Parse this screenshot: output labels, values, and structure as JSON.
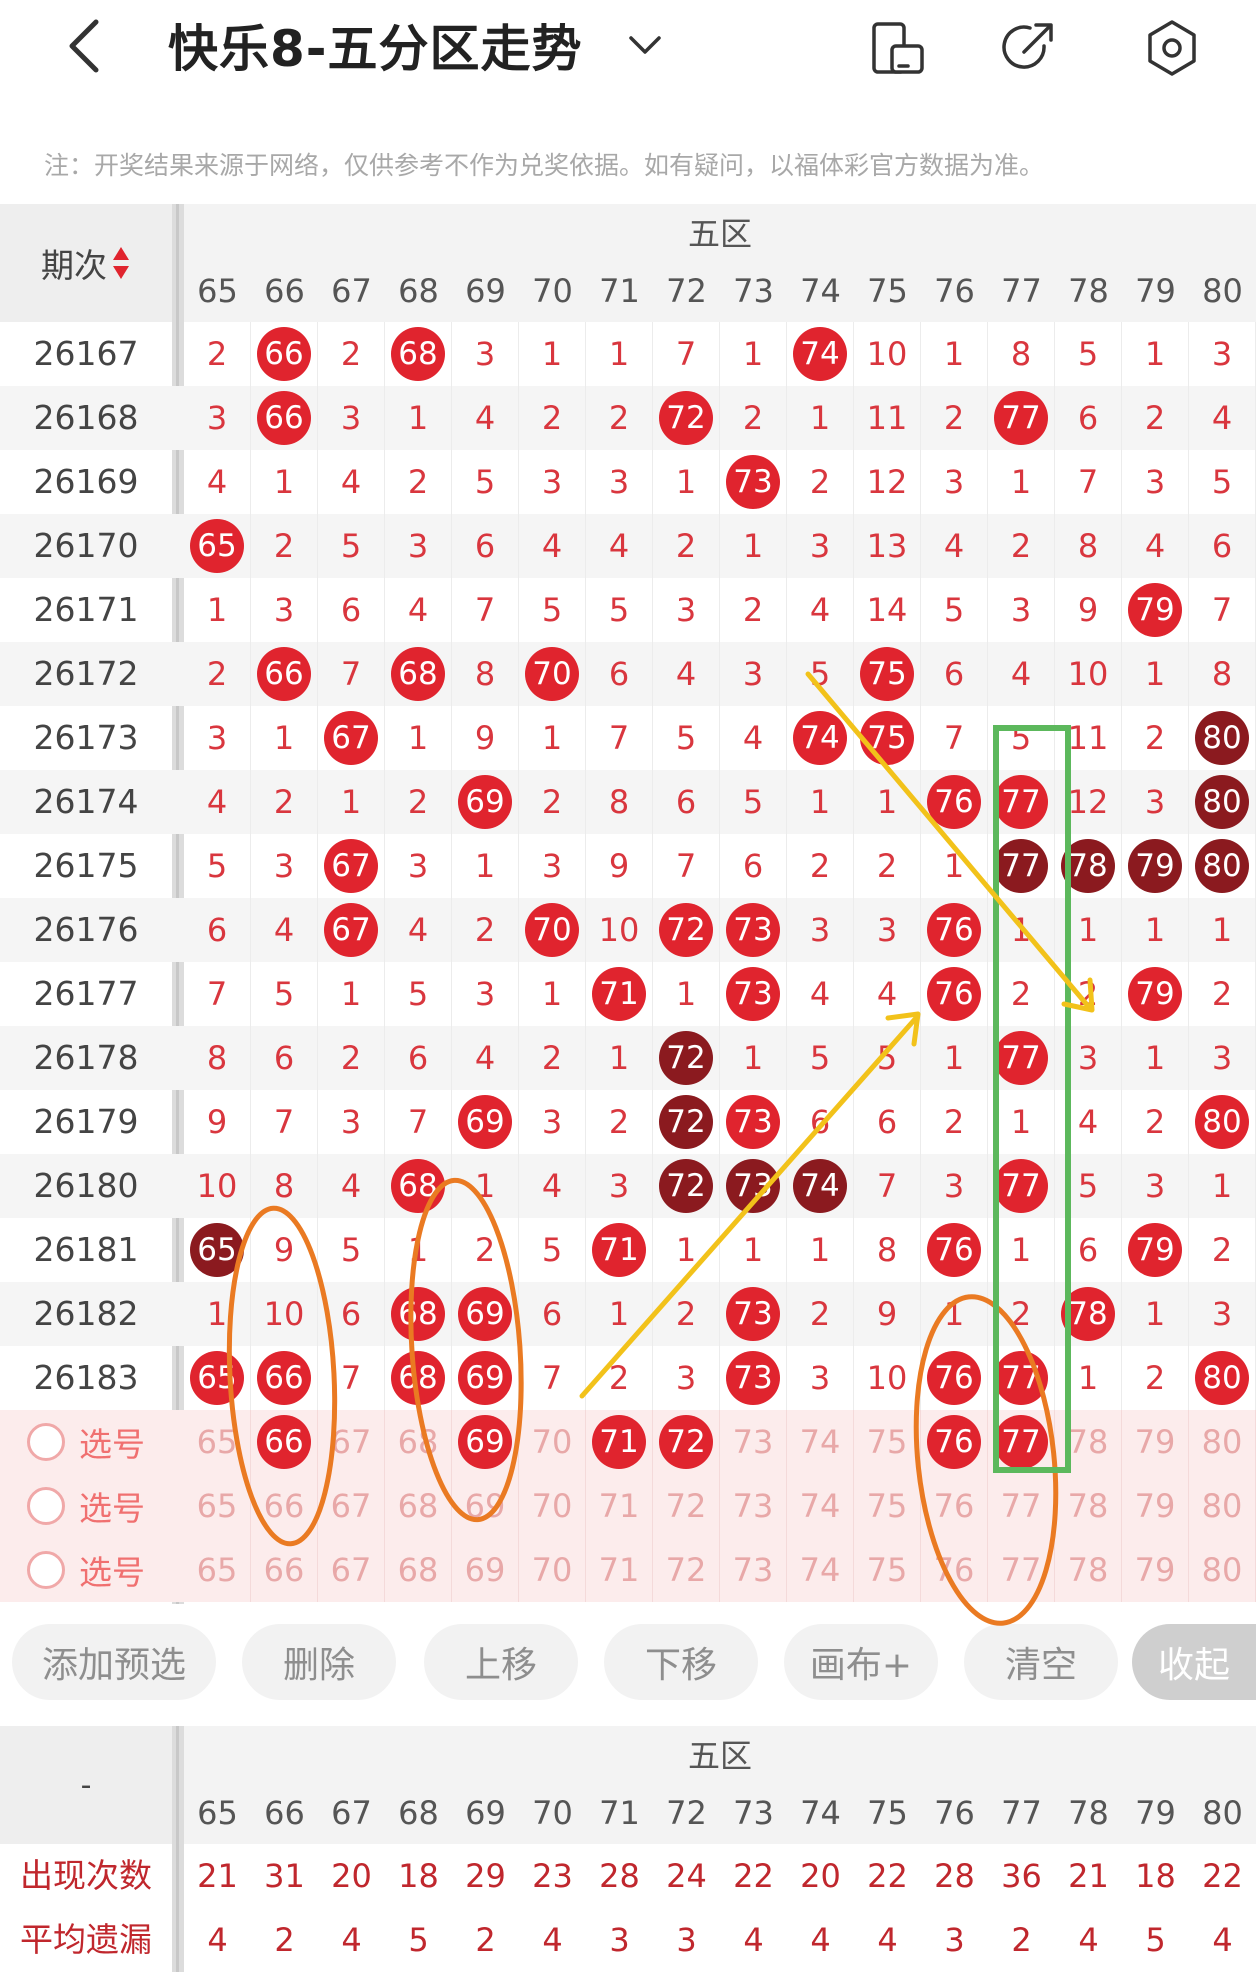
{
  "header": {
    "title": "快乐8-五分区走势",
    "icons": [
      "back-arrow-icon",
      "chevron-down-icon",
      "phone-rotate-icon",
      "share-icon",
      "settings-hex-icon"
    ]
  },
  "notice": "注：开奖结果来源于网络，仅供参考不作为兑奖依据。如有疑问，以福体彩官方数据为准。",
  "table": {
    "issue_header": "期次",
    "zone_label": "五区",
    "columns": [
      "65",
      "66",
      "67",
      "68",
      "69",
      "70",
      "71",
      "72",
      "73",
      "74",
      "75",
      "76",
      "77",
      "78",
      "79",
      "80"
    ],
    "rows": [
      {
        "issue": "26167",
        "cells": [
          "2",
          "66",
          "2",
          "68",
          "3",
          "1",
          "1",
          "7",
          "1",
          "74",
          "10",
          "1",
          "8",
          "5",
          "1",
          "3"
        ],
        "hits": [
          1,
          3,
          9
        ],
        "dark": []
      },
      {
        "issue": "26168",
        "cells": [
          "3",
          "66",
          "3",
          "1",
          "4",
          "2",
          "2",
          "72",
          "2",
          "1",
          "11",
          "2",
          "77",
          "6",
          "2",
          "4"
        ],
        "hits": [
          1,
          7,
          12
        ],
        "dark": []
      },
      {
        "issue": "26169",
        "cells": [
          "4",
          "1",
          "4",
          "2",
          "5",
          "3",
          "3",
          "1",
          "73",
          "2",
          "12",
          "3",
          "1",
          "7",
          "3",
          "5"
        ],
        "hits": [
          8
        ],
        "dark": []
      },
      {
        "issue": "26170",
        "cells": [
          "65",
          "2",
          "5",
          "3",
          "6",
          "4",
          "4",
          "2",
          "1",
          "3",
          "13",
          "4",
          "2",
          "8",
          "4",
          "6"
        ],
        "hits": [
          0
        ],
        "dark": []
      },
      {
        "issue": "26171",
        "cells": [
          "1",
          "3",
          "6",
          "4",
          "7",
          "5",
          "5",
          "3",
          "2",
          "4",
          "14",
          "5",
          "3",
          "9",
          "79",
          "7"
        ],
        "hits": [
          14
        ],
        "dark": []
      },
      {
        "issue": "26172",
        "cells": [
          "2",
          "66",
          "7",
          "68",
          "8",
          "70",
          "6",
          "4",
          "3",
          "5",
          "75",
          "6",
          "4",
          "10",
          "1",
          "8"
        ],
        "hits": [
          1,
          3,
          5,
          10
        ],
        "dark": []
      },
      {
        "issue": "26173",
        "cells": [
          "3",
          "1",
          "67",
          "1",
          "9",
          "1",
          "7",
          "5",
          "4",
          "74",
          "75",
          "7",
          "5",
          "11",
          "2",
          "80"
        ],
        "hits": [
          2,
          9,
          10
        ],
        "dark": [
          15
        ]
      },
      {
        "issue": "26174",
        "cells": [
          "4",
          "2",
          "1",
          "2",
          "69",
          "2",
          "8",
          "6",
          "5",
          "1",
          "1",
          "76",
          "77",
          "12",
          "3",
          "80"
        ],
        "hits": [
          4,
          11,
          12
        ],
        "dark": [
          15
        ]
      },
      {
        "issue": "26175",
        "cells": [
          "5",
          "3",
          "67",
          "3",
          "1",
          "3",
          "9",
          "7",
          "6",
          "2",
          "2",
          "1",
          "77",
          "78",
          "79",
          "80"
        ],
        "hits": [
          2
        ],
        "dark": [
          12,
          13,
          14,
          15
        ]
      },
      {
        "issue": "26176",
        "cells": [
          "6",
          "4",
          "67",
          "4",
          "2",
          "70",
          "10",
          "72",
          "73",
          "3",
          "3",
          "76",
          "1",
          "1",
          "1",
          "1"
        ],
        "hits": [
          2,
          5,
          7,
          8,
          11
        ],
        "dark": []
      },
      {
        "issue": "26177",
        "cells": [
          "7",
          "5",
          "1",
          "5",
          "3",
          "1",
          "71",
          "1",
          "73",
          "4",
          "4",
          "76",
          "2",
          "2",
          "79",
          "2"
        ],
        "hits": [
          6,
          8,
          11,
          14
        ],
        "dark": []
      },
      {
        "issue": "26178",
        "cells": [
          "8",
          "6",
          "2",
          "6",
          "4",
          "2",
          "1",
          "72",
          "1",
          "5",
          "5",
          "1",
          "77",
          "3",
          "1",
          "3"
        ],
        "hits": [
          12
        ],
        "dark": [
          7
        ]
      },
      {
        "issue": "26179",
        "cells": [
          "9",
          "7",
          "3",
          "7",
          "69",
          "3",
          "2",
          "72",
          "73",
          "6",
          "6",
          "2",
          "1",
          "4",
          "2",
          "80"
        ],
        "hits": [
          4,
          8,
          15
        ],
        "dark": [
          7
        ]
      },
      {
        "issue": "26180",
        "cells": [
          "10",
          "8",
          "4",
          "68",
          "1",
          "4",
          "3",
          "72",
          "73",
          "74",
          "7",
          "3",
          "77",
          "5",
          "3",
          "1"
        ],
        "hits": [
          3,
          12
        ],
        "dark": [
          7,
          8,
          9
        ]
      },
      {
        "issue": "26181",
        "cells": [
          "65",
          "9",
          "5",
          "1",
          "2",
          "5",
          "71",
          "1",
          "1",
          "1",
          "8",
          "76",
          "1",
          "6",
          "79",
          "2"
        ],
        "hits": [
          6,
          11,
          14
        ],
        "dark": [
          0
        ]
      },
      {
        "issue": "26182",
        "cells": [
          "1",
          "10",
          "6",
          "68",
          "69",
          "6",
          "1",
          "2",
          "73",
          "2",
          "9",
          "1",
          "2",
          "78",
          "1",
          "3"
        ],
        "hits": [
          3,
          4,
          8,
          13
        ],
        "dark": []
      },
      {
        "issue": "26183",
        "cells": [
          "65",
          "66",
          "7",
          "68",
          "69",
          "7",
          "2",
          "3",
          "73",
          "3",
          "10",
          "76",
          "77",
          "1",
          "2",
          "80"
        ],
        "hits": [
          0,
          1,
          3,
          4,
          8,
          11,
          12,
          15
        ],
        "dark": []
      }
    ],
    "pick_rows": [
      {
        "label": "选号",
        "cells": [
          "65",
          "66",
          "67",
          "68",
          "69",
          "70",
          "71",
          "72",
          "73",
          "74",
          "75",
          "76",
          "77",
          "78",
          "79",
          "80"
        ],
        "hits": [
          1,
          4,
          6,
          7,
          11,
          12
        ]
      },
      {
        "label": "选号",
        "cells": [
          "65",
          "66",
          "67",
          "68",
          "69",
          "70",
          "71",
          "72",
          "73",
          "74",
          "75",
          "76",
          "77",
          "78",
          "79",
          "80"
        ],
        "hits": []
      },
      {
        "label": "选号",
        "cells": [
          "65",
          "66",
          "67",
          "68",
          "69",
          "70",
          "71",
          "72",
          "73",
          "74",
          "75",
          "76",
          "77",
          "78",
          "79",
          "80"
        ],
        "hits": []
      }
    ]
  },
  "toolbar": {
    "add": "添加预选",
    "delete": "删除",
    "up": "上移",
    "down": "下移",
    "canvas": "画布+",
    "clear": "清空",
    "collapse": "收起"
  },
  "stats": {
    "corner": "-",
    "zone_label": "五区",
    "columns": [
      "65",
      "66",
      "67",
      "68",
      "69",
      "70",
      "71",
      "72",
      "73",
      "74",
      "75",
      "76",
      "77",
      "78",
      "79",
      "80"
    ],
    "rows": [
      {
        "label": "出现次数",
        "values": [
          "21",
          "31",
          "20",
          "18",
          "29",
          "23",
          "28",
          "24",
          "22",
          "20",
          "22",
          "28",
          "36",
          "21",
          "18",
          "22"
        ]
      },
      {
        "label": "平均遗漏",
        "values": [
          "4",
          "2",
          "4",
          "5",
          "2",
          "4",
          "3",
          "3",
          "4",
          "4",
          "4",
          "3",
          "2",
          "4",
          "5",
          "4"
        ]
      }
    ]
  },
  "colors": {
    "hit_ball": "#e0242e",
    "dark_ball": "#8b1a1f",
    "miss_text": "#d9363e",
    "annotation_orange": "#ea7a22",
    "annotation_yellow": "#f2c21a",
    "annotation_green": "#5cb85c"
  }
}
